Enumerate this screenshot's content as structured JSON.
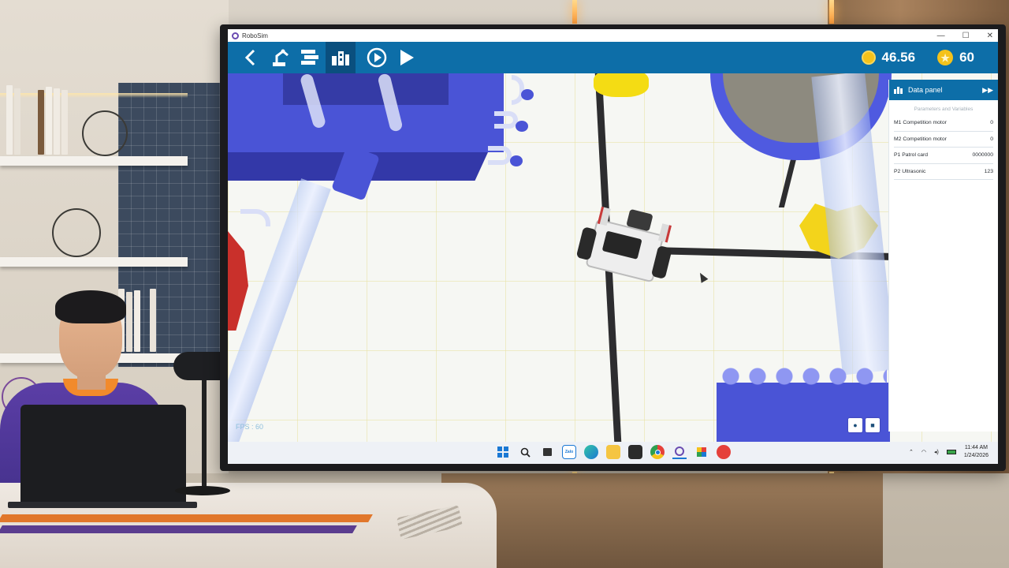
{
  "window": {
    "title": "RoboSim",
    "minimize": "—",
    "maximize": "☐",
    "close": "✕"
  },
  "toolbar": {
    "buttons": [
      {
        "name": "back-button",
        "icon": "chevron-left-icon"
      },
      {
        "name": "robot-arm-button",
        "icon": "robot-arm-icon"
      },
      {
        "name": "blocks-button",
        "icon": "code-blocks-icon"
      },
      {
        "name": "map-button",
        "icon": "city-map-icon",
        "active": true
      },
      {
        "name": "play-circle-button",
        "icon": "play-circle-icon"
      },
      {
        "name": "run-button",
        "icon": "play-icon"
      }
    ],
    "timer": "46.56",
    "score": "60"
  },
  "scene": {
    "fps": "FPS : 60"
  },
  "data_panel": {
    "title": "Data panel",
    "subtitle": "Parameters and Variables",
    "rows": [
      {
        "label": "M1 Competition motor",
        "value": "0"
      },
      {
        "label": "M2 Competition motor",
        "value": "0"
      },
      {
        "label": "P1 Patrol card",
        "value": "0000000"
      },
      {
        "label": "P2 Ultrasonic",
        "value": "123"
      }
    ]
  },
  "taskbar": {
    "time": "11:44 AM",
    "date": "1/24/2026"
  },
  "colors": {
    "toolbar": "#0d6ea8",
    "toolbar_active": "#0a4f7e",
    "obstacle_blue": "#4a54d6",
    "star_yellow": "#f4c21b"
  }
}
